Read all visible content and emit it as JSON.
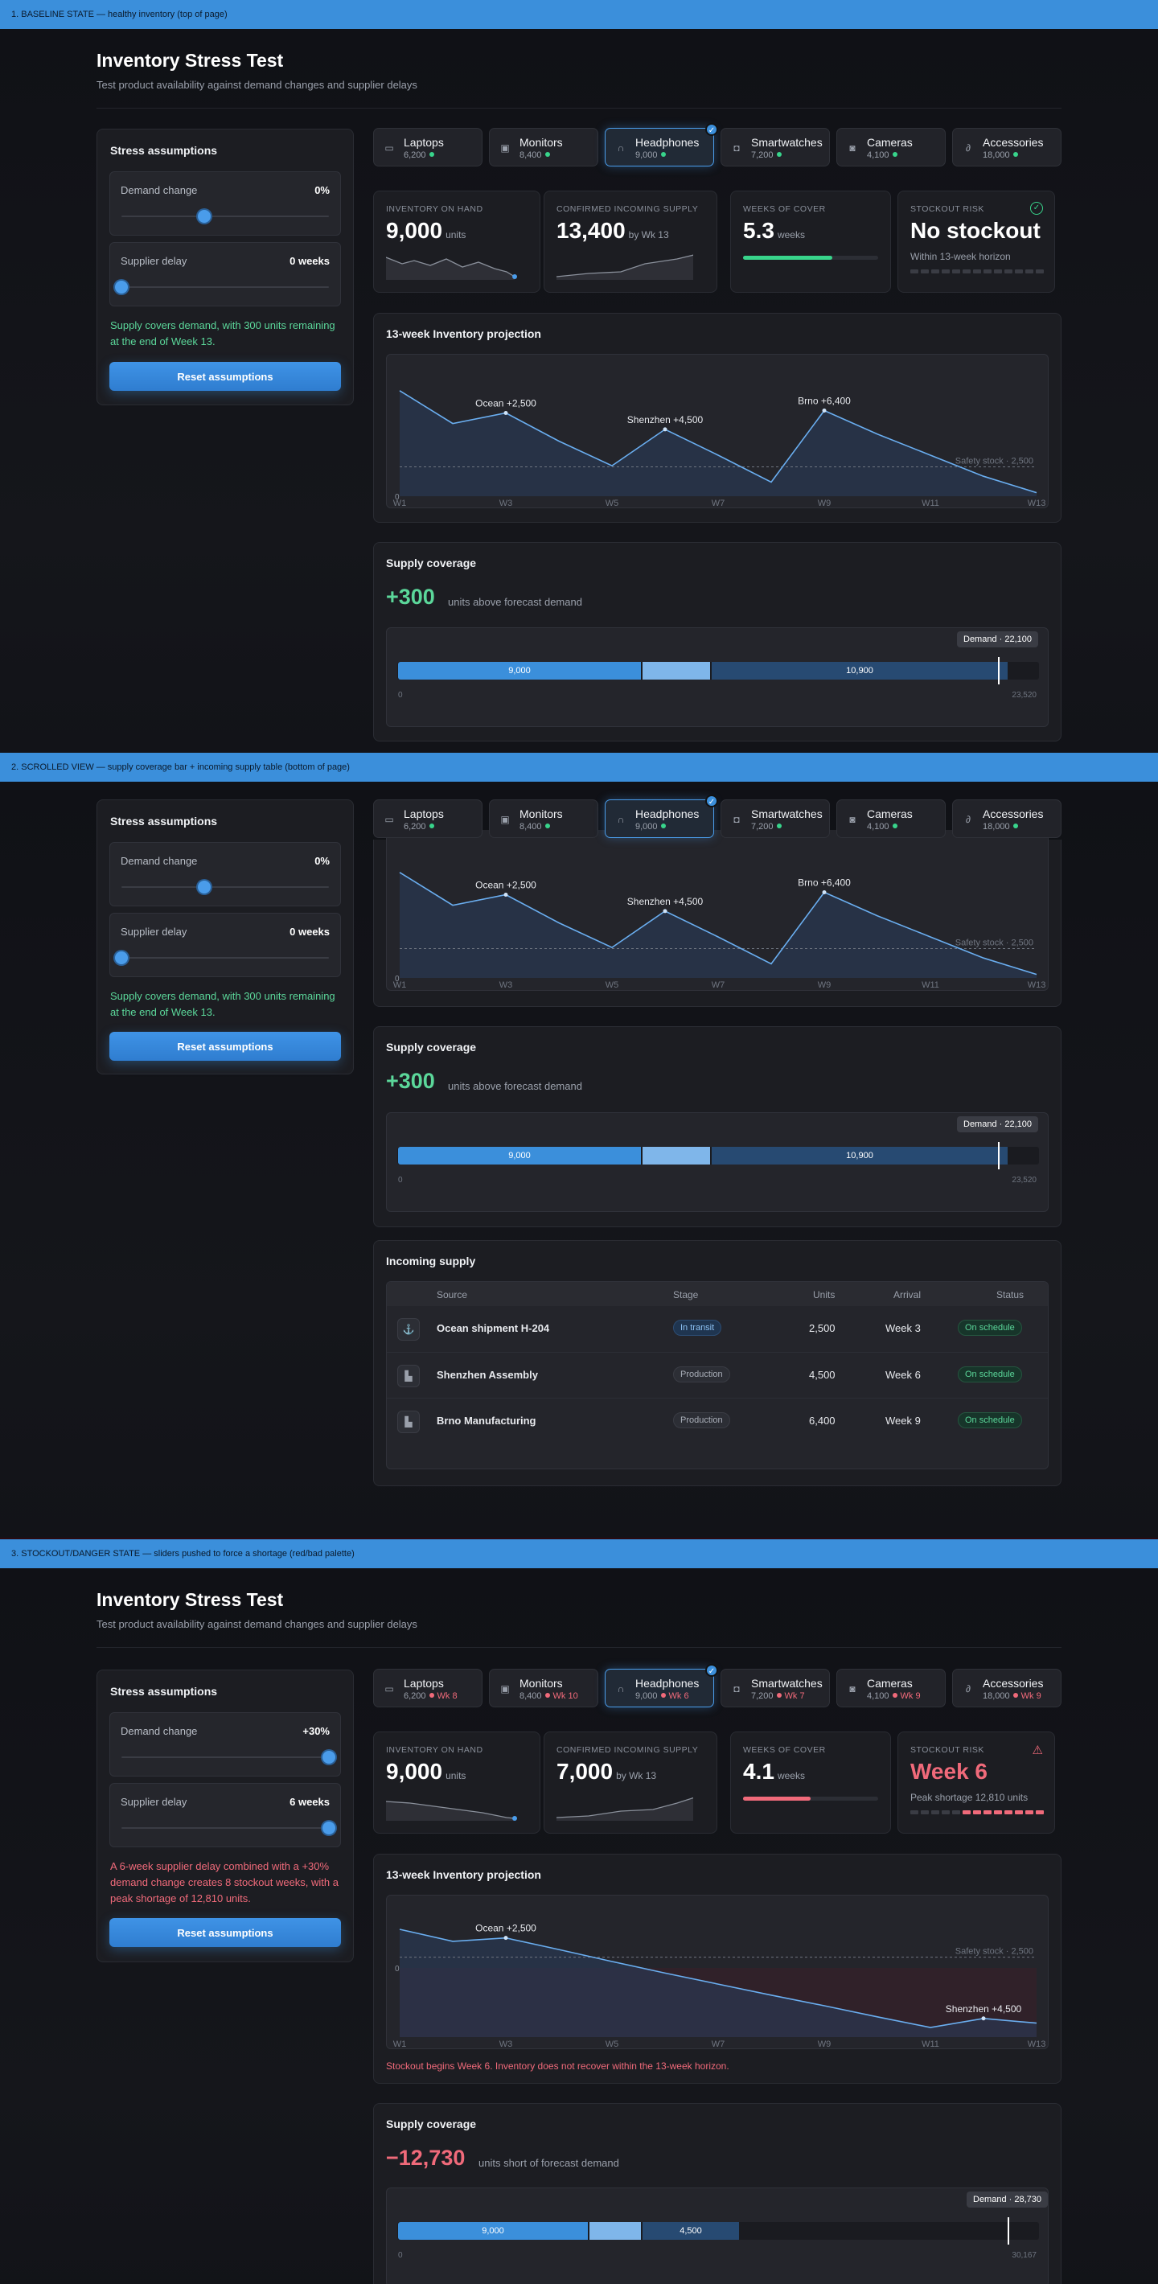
{
  "banners": {
    "s1": "1. BASELINE STATE — healthy inventory (top of page)",
    "s2": "2. SCROLLED VIEW — supply coverage bar + incoming supply table (bottom of page)",
    "s3": "3. STOCKOUT/DANGER STATE — sliders pushed to force a shortage (red/bad palette)"
  },
  "header": {
    "title": "Inventory Stress Test",
    "subtitle": "Test product availability against demand changes and supplier delays"
  },
  "assumptions": {
    "title": "Stress assumptions",
    "demand_label": "Demand change",
    "delay_label": "Supplier delay",
    "reset_label": "Reset assumptions"
  },
  "baseline": {
    "demand_value": "0%",
    "delay_value": "0 weeks",
    "message": "Supply covers demand, with 300 units remaining at the end of Week 13.",
    "products": [
      {
        "name": "Laptops",
        "count": "6,200",
        "icon": "laptop-icon"
      },
      {
        "name": "Monitors",
        "count": "8,400",
        "icon": "monitor-icon"
      },
      {
        "name": "Headphones",
        "count": "9,000",
        "icon": "headphones-icon"
      },
      {
        "name": "Smartwatches",
        "count": "7,200",
        "icon": "watch-icon"
      },
      {
        "name": "Cameras",
        "count": "4,100",
        "icon": "camera-icon"
      },
      {
        "name": "Accessories",
        "count": "18,000",
        "icon": "accessories-icon"
      }
    ],
    "kpi": {
      "on_hand_label": "INVENTORY ON HAND",
      "on_hand_value": "9,000",
      "on_hand_unit": "units",
      "incoming_label": "CONFIRMED INCOMING SUPPLY",
      "incoming_value": "13,400",
      "incoming_unit": "by Wk 13",
      "cover_label": "WEEKS OF COVER",
      "cover_value": "5.3",
      "cover_unit": "weeks",
      "cover_fill": 0.66,
      "risk_label": "STOCKOUT RISK",
      "risk_value": "No stockout",
      "risk_sub": "Within 13-week horizon"
    },
    "coverage": {
      "title": "Supply coverage",
      "big": "+300",
      "sub": "units above forecast demand",
      "demand_tag": "Demand · 22,100",
      "seg1": "9,000",
      "seg3": "10,900",
      "axis_min": "0",
      "axis_max": "23,520"
    }
  },
  "projection_title": "13-week Inventory projection",
  "weeks": [
    "W1",
    "W3",
    "W5",
    "W7",
    "W9",
    "W11",
    "W13"
  ],
  "safety_label": "Safety stock · 2,500",
  "zero_label": "0",
  "chart_data": [
    {
      "type": "area",
      "title": "13-week Inventory projection",
      "x": [
        "W1",
        "W2",
        "W3",
        "W4",
        "W5",
        "W6",
        "W7",
        "W8",
        "W9",
        "W10",
        "W11",
        "W12",
        "W13"
      ],
      "values": [
        9000,
        6200,
        7100,
        4700,
        2600,
        5700,
        3500,
        1200,
        7300,
        5300,
        3500,
        1700,
        300
      ],
      "safety_stock": 2500,
      "annotations": [
        "Ocean +2,500",
        "Shenzhen +4,500",
        "Brno +6,400"
      ]
    },
    {
      "type": "area",
      "title": "13-week Inventory projection",
      "x": [
        "W1",
        "W2",
        "W3",
        "W4",
        "W5",
        "W6",
        "W7",
        "W8",
        "W9",
        "W10",
        "W11",
        "W12",
        "W13"
      ],
      "values": [
        9000,
        6200,
        7000,
        4300,
        1500,
        -1300,
        -4100,
        -6900,
        -9600,
        -12400,
        -15100,
        -12810,
        -14000
      ],
      "safety_stock": 2500,
      "annotations": [
        "Ocean +2,500",
        "Shenzhen +4,500"
      ]
    }
  ],
  "incoming": {
    "title": "Incoming supply",
    "headers": [
      "Source",
      "Stage",
      "Units",
      "Arrival",
      "Status"
    ],
    "rows": [
      {
        "source": "Ocean shipment H-204",
        "stage": "In transit",
        "units": "2,500",
        "arrival": "Week 3",
        "status": "On schedule"
      },
      {
        "source": "Shenzhen Assembly",
        "stage": "Production",
        "units": "4,500",
        "arrival": "Week 6",
        "status": "On schedule"
      },
      {
        "source": "Brno Manufacturing",
        "stage": "Production",
        "units": "6,400",
        "arrival": "Week 9",
        "status": "On schedule"
      }
    ]
  },
  "danger": {
    "demand_value": "+30%",
    "delay_value": "6 weeks",
    "message": "A 6-week supplier delay combined with a +30% demand change creates 8 stockout weeks, with a peak shortage of 12,810 units.",
    "product_weeks": [
      "Wk 8",
      "Wk 10",
      "Wk 6",
      "Wk 7",
      "Wk 9",
      "Wk 9"
    ],
    "kpi": {
      "on_hand_value": "9,000",
      "incoming_value": "7,000",
      "cover_value": "4.1",
      "cover_fill": 0.5,
      "risk_value": "Week 6",
      "risk_sub": "Peak shortage 12,810 units"
    },
    "note": "Stockout begins Week 6. Inventory does not recover within the 13-week horizon.",
    "coverage": {
      "big": "−12,730",
      "sub": "units short of forecast demand",
      "demand_tag": "Demand · 28,730",
      "seg1": "9,000",
      "seg3": "4,500",
      "axis_min": "0",
      "axis_max": "30,167"
    }
  },
  "colors": {
    "accent": "#3b8fdb",
    "good": "#38d48b",
    "bad": "#f06a7a"
  }
}
